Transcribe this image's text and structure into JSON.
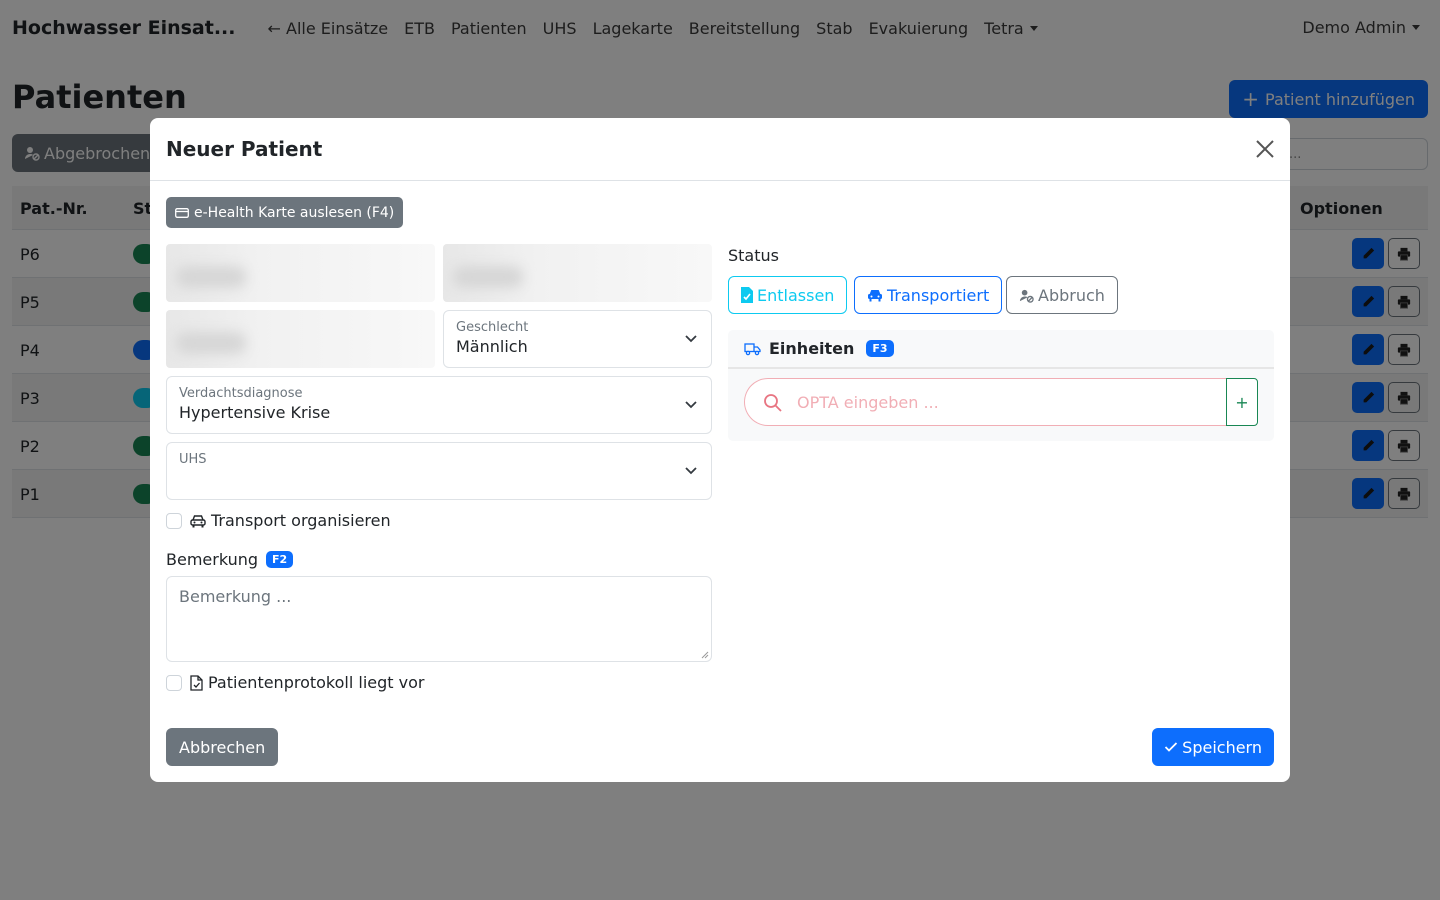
{
  "navbar": {
    "brand": "Hochwasser Einsat...",
    "links": [
      "← Alle Einsätze",
      "ETB",
      "Patienten",
      "UHS",
      "Lagekarte",
      "Bereitstellung",
      "Stab",
      "Evakuierung"
    ],
    "tetra": "Tetra",
    "user": "Demo Admin"
  },
  "page": {
    "title": "Patienten",
    "add_button": "Patient hinzufügen",
    "filter_button": "Abgebrochen",
    "search_placeholder": "..."
  },
  "table": {
    "headers": {
      "nr": "Pat.-Nr.",
      "status": "St",
      "options": "Optionen"
    },
    "rows": [
      {
        "nr": "P6",
        "status_color": "#198754"
      },
      {
        "nr": "P5",
        "status_color": "#198754"
      },
      {
        "nr": "P4",
        "status_color": "#0d6efd"
      },
      {
        "nr": "P3",
        "status_color": "#0dcaf0"
      },
      {
        "nr": "P2",
        "status_color": "#198754"
      },
      {
        "nr": "P1",
        "status_color": "#198754"
      }
    ]
  },
  "modal": {
    "title": "Neuer Patient",
    "ehealth_button": "e-Health Karte auslesen (F4)",
    "gender": {
      "label": "Geschlecht",
      "value": "Männlich"
    },
    "diagnosis": {
      "label": "Verdachtsdiagnose",
      "value": "Hypertensive Krise"
    },
    "uhs": {
      "label": "UHS",
      "value": ""
    },
    "transport_checkbox": "Transport organisieren",
    "remark": {
      "label": "Bemerkung",
      "shortcut": "F2",
      "placeholder": "Bemerkung ..."
    },
    "protocol_checkbox": "Patientenprotokoll liegt vor",
    "status": {
      "label": "Status",
      "buttons": [
        {
          "label": "Entlassen",
          "color": "#0dcaf0"
        },
        {
          "label": "Transportiert",
          "color": "#0d6efd"
        },
        {
          "label": "Abbruch",
          "color": "#6c757d"
        }
      ]
    },
    "units": {
      "label": "Einheiten",
      "shortcut": "F3",
      "placeholder": "OPTA eingeben ...",
      "add": "+"
    },
    "cancel_button": "Abbrechen",
    "save_button": "Speichern"
  }
}
